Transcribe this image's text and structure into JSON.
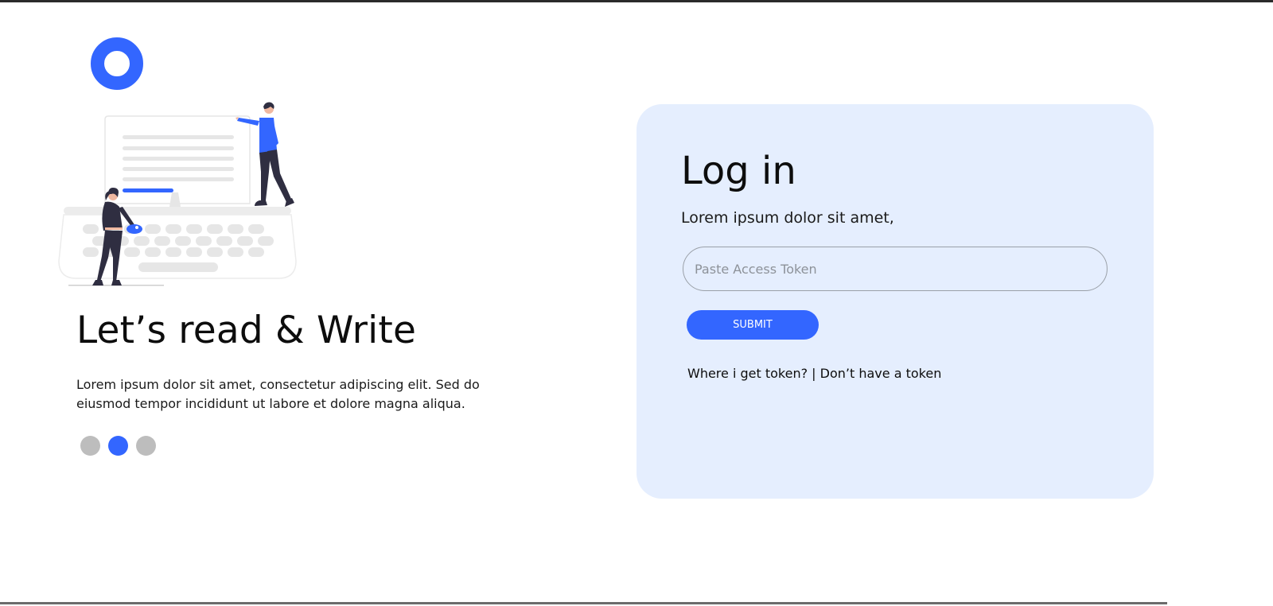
{
  "hero": {
    "title": "Let’s read & Write",
    "description": "Lorem ipsum dolor sit amet, consectetur adipiscing elit. Sed do eiusmod tempor incididunt ut labore et dolore magna aliqua.",
    "carousel_active_index": 1,
    "carousel_total": 3
  },
  "login": {
    "title": "Log in",
    "subtitle": "Lorem ipsum dolor sit amet,",
    "token_placeholder": "Paste Access Token",
    "token_value": "",
    "submit_label": "SUBMIT",
    "where_link_label": "Where i get token?",
    "separator": " | ",
    "no_token_link_label": "Don’t have a token"
  },
  "icons": {
    "logo": "ring-logo-icon",
    "illustration": "people-with-typewriter-illustration"
  },
  "colors": {
    "accent": "#3366ff",
    "card_background": "#e5eefe",
    "dot_inactive": "#bdbdbd",
    "text": "#0d0d0d"
  }
}
